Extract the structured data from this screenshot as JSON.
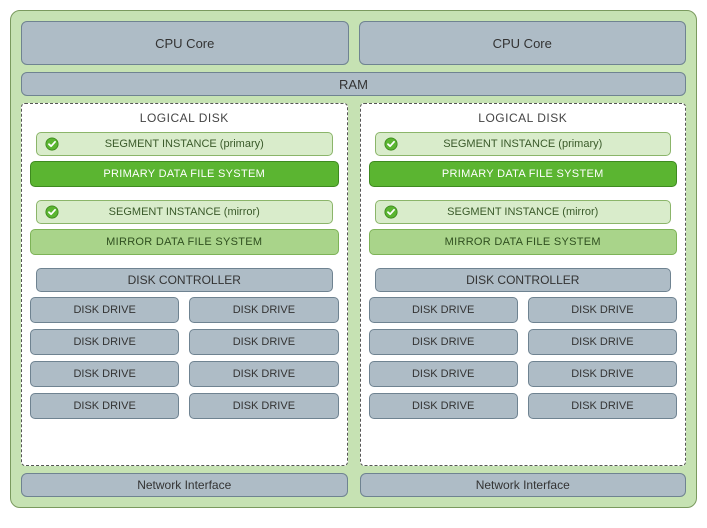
{
  "cpu": {
    "core0": "CPU Core",
    "core1": "CPU Core"
  },
  "ram": "RAM",
  "logical_disks": [
    {
      "title": "LOGICAL DISK",
      "segment_primary": "SEGMENT INSTANCE (primary)",
      "primary_fs": "PRIMARY DATA FILE SYSTEM",
      "segment_mirror": "SEGMENT INSTANCE (mirror)",
      "mirror_fs": "MIRROR DATA FILE SYSTEM",
      "disk_controller": "DISK CONTROLLER",
      "drives": [
        "DISK DRIVE",
        "DISK DRIVE",
        "DISK DRIVE",
        "DISK DRIVE",
        "DISK DRIVE",
        "DISK DRIVE",
        "DISK DRIVE",
        "DISK DRIVE"
      ]
    },
    {
      "title": "LOGICAL DISK",
      "segment_primary": "SEGMENT INSTANCE (primary)",
      "primary_fs": "PRIMARY DATA FILE SYSTEM",
      "segment_mirror": "SEGMENT INSTANCE (mirror)",
      "mirror_fs": "MIRROR DATA FILE SYSTEM",
      "disk_controller": "DISK CONTROLLER",
      "drives": [
        "DISK DRIVE",
        "DISK DRIVE",
        "DISK DRIVE",
        "DISK DRIVE",
        "DISK DRIVE",
        "DISK DRIVE",
        "DISK DRIVE",
        "DISK DRIVE"
      ]
    }
  ],
  "network": {
    "if0": "Network Interface",
    "if1": "Network Interface"
  },
  "colors": {
    "host_bg": "#c6e2b3",
    "hw_block": "#aebcc6",
    "seg_instance": "#d9eccb",
    "primary_fs": "#5bb531",
    "mirror_fs": "#a9d48a"
  }
}
